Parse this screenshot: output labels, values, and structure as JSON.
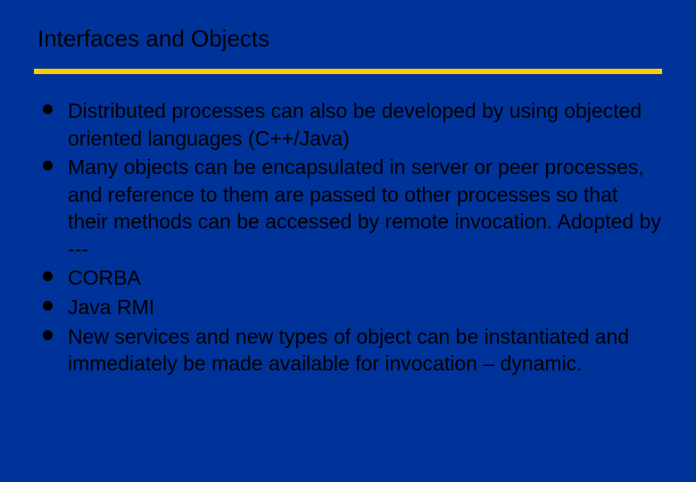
{
  "slide": {
    "title": "Interfaces and Objects",
    "bullets": [
      "Distributed processes can also be developed by using objected oriented languages (C++/Java)",
      "Many objects can be encapsulated in server or peer processes, and reference to them are passed to other processes so that their methods can be accessed by remote invocation.    Adopted by ---",
      "CORBA",
      "Java RMI",
      "New services and new types of object can be instantiated and immediately be made available for invocation – dynamic."
    ]
  }
}
